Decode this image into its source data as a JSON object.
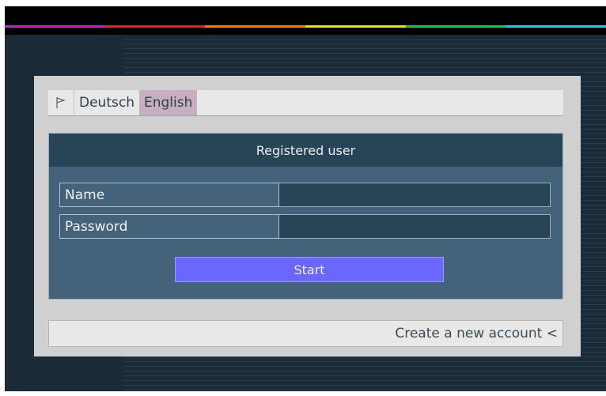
{
  "colors": {
    "rainbow": [
      "#c21fcf",
      "#e0251a",
      "#ee7b10",
      "#e7de1b",
      "#1ec43b",
      "#26c8e8"
    ],
    "accent": "#6a67ff",
    "active_language": "#c7afbf"
  },
  "language_bar": {
    "icon": "flag-icon",
    "languages": [
      {
        "label": "Deutsch",
        "active": false
      },
      {
        "label": "English",
        "active": true
      }
    ]
  },
  "login": {
    "heading": "Registered user",
    "name_label": "Name",
    "name_value": "",
    "password_label": "Password",
    "password_value": "",
    "start_label": "Start"
  },
  "footer": {
    "create_account": "Create a new account <"
  }
}
